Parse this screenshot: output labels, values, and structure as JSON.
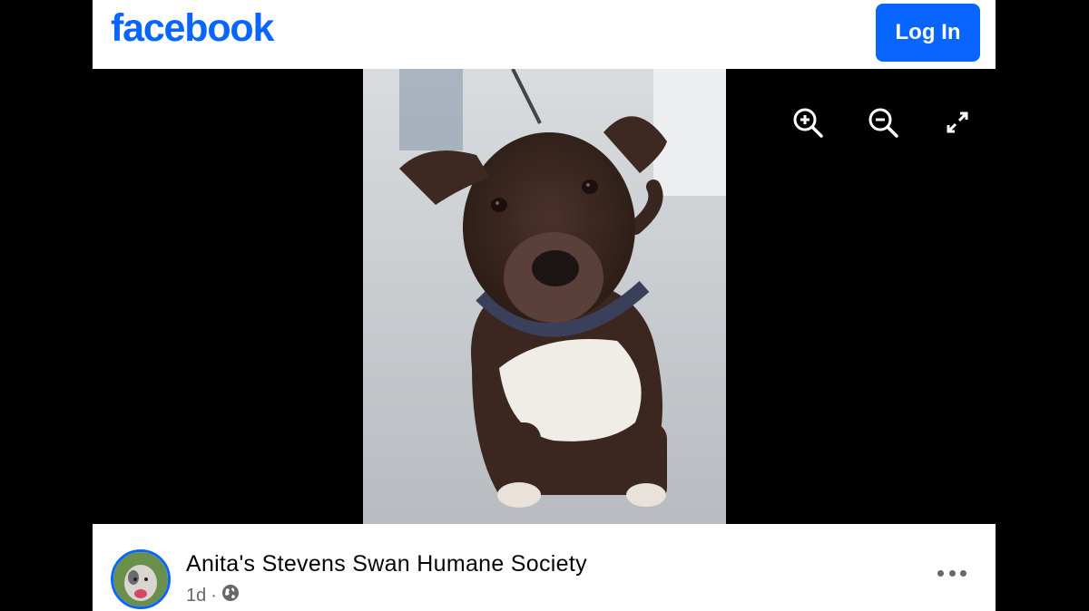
{
  "header": {
    "logo_text": "facebook",
    "login_label": "Log In",
    "brand_color": "#0866ff"
  },
  "viewer": {
    "photo_alt": "dog",
    "tools": [
      "zoom-in-icon",
      "zoom-out-icon",
      "fullscreen-icon"
    ]
  },
  "post": {
    "page_name": "Anita's Stevens Swan Humane Society",
    "time": "1d",
    "separator": "·",
    "privacy_icon": "globe-icon"
  }
}
